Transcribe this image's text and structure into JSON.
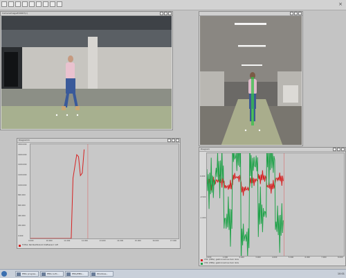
{
  "toolbar": {
    "buttons": [
      "new",
      "open",
      "save",
      "cut",
      "copy",
      "paste",
      "undo",
      "print",
      "help"
    ],
    "close_glyph": "×"
  },
  "video_left": {
    "title": "CameraImage#00067(c)"
  },
  "video_right": {
    "title": ""
  },
  "graph_left": {
    "title": "Diagramm",
    "x_ticks": [
      "9.000",
      "10.000",
      "11.000",
      "12.000",
      "13.000",
      "14.000",
      "15.000",
      "16.000",
      "17.000"
    ],
    "y_ticks": [
      "1800.000",
      "1600.000",
      "1400.000",
      "1200.000",
      "1000.000",
      "800.000",
      "600.000",
      "400.000",
      "200.000",
      "0.000"
    ],
    "legend": [
      {
        "label": "TOTAL: Rambuktikulum Kraftsensor: left",
        "color": "#d62020"
      }
    ]
  },
  "graph_right": {
    "title": "Diagram",
    "x_ticks": [
      "0.000",
      "1.000",
      "2.000",
      "3.000",
      "4.000",
      "5.000",
      "6.000",
      "7.000",
      "8.000"
    ],
    "y_ticks": [
      "0.000",
      "-0.500",
      "-1.000"
    ],
    "legend": [
      {
        "label": "CH1: (EMG): gastrocnemius med. links",
        "color": "#d62020"
      },
      {
        "label": "CH2: (EMG): gastrocnemius med. links",
        "color": "#21a24a"
      }
    ]
  },
  "chart_data": [
    {
      "type": "line",
      "title": "Diagramm",
      "xlim": [
        9000,
        17000
      ],
      "ylim": [
        0,
        1800
      ],
      "series": [
        {
          "name": "TOTAL: Rambuktikulum Kraftsensor: left",
          "color": "#d62020",
          "x": [
            9000,
            9500,
            10000,
            10500,
            11000,
            11100,
            11200,
            11300,
            11400,
            11500,
            11600,
            11700,
            11800,
            11900
          ],
          "y": [
            0,
            0,
            0,
            0,
            0,
            0,
            0,
            1150,
            1380,
            1600,
            1560,
            1200,
            1250,
            1700
          ]
        }
      ],
      "grid": false,
      "legend_position": "bottom-left"
    },
    {
      "type": "line",
      "title": "Diagram",
      "xlim": [
        0,
        8000
      ],
      "ylim": [
        -1.2,
        0.5
      ],
      "series": [
        {
          "name": "CH1: (EMG): gastrocnemius med. links",
          "color": "#d62020",
          "x": [
            0,
            500,
            1000,
            1500,
            2000,
            2500,
            3000,
            3500,
            4000,
            4500
          ],
          "y": [
            0.0,
            0.05,
            -0.05,
            0.1,
            -0.1,
            0.05,
            0.1,
            -0.05,
            0.08,
            0.0
          ]
        },
        {
          "name": "CH2: (EMG): gastrocnemius med. links",
          "color": "#21a24a",
          "x": [
            0,
            500,
            1000,
            1500,
            2000,
            2500,
            3000,
            3500,
            4000,
            4500
          ],
          "y": [
            0.0,
            0.2,
            -0.6,
            0.45,
            -0.9,
            0.3,
            -0.5,
            0.4,
            -0.7,
            0.0
          ]
        }
      ],
      "grid": false,
      "legend_position": "bottom-left"
    }
  ],
  "taskbar": {
    "items": [
      "EMG progres...",
      "EMG Aufn...",
      "EMG/EMG...",
      "Windows..."
    ],
    "tray_time": "10:01"
  },
  "colors": {
    "emg_red": "#d62020",
    "emg_green": "#21a24a"
  }
}
